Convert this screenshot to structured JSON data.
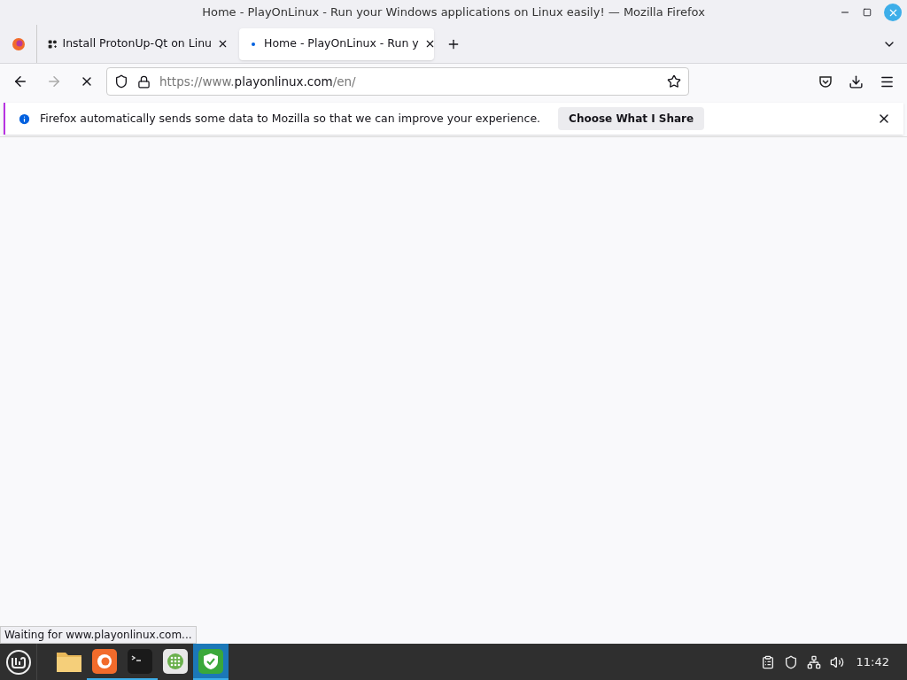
{
  "window": {
    "title": "Home - PlayOnLinux - Run your Windows applications on Linux easily! — Mozilla Firefox"
  },
  "tabs": [
    {
      "label": "Install ProtonUp-Qt on Linu",
      "selected": false,
      "loading": false
    },
    {
      "label": "Home - PlayOnLinux - Run y",
      "selected": true,
      "loading": true
    }
  ],
  "nav": {
    "forward_disabled": true,
    "loading": true
  },
  "url": {
    "prefix": "https://www.",
    "host": "playonlinux.com",
    "path": "/en/"
  },
  "notification": {
    "message": "Firefox automatically sends some data to Mozilla so that we can improve your experience.",
    "button": "Choose What I Share"
  },
  "status_bar": "Waiting for www.playonlinux.com...",
  "taskbar": {
    "apps": [
      {
        "kind": "files",
        "running": false,
        "selected": false
      },
      {
        "kind": "firefox",
        "running": true,
        "selected": false
      },
      {
        "kind": "terminal",
        "running": true,
        "selected": false
      },
      {
        "kind": "apps",
        "running": false,
        "selected": false
      },
      {
        "kind": "shield",
        "running": true,
        "selected": true
      }
    ],
    "clock": "11:42"
  }
}
